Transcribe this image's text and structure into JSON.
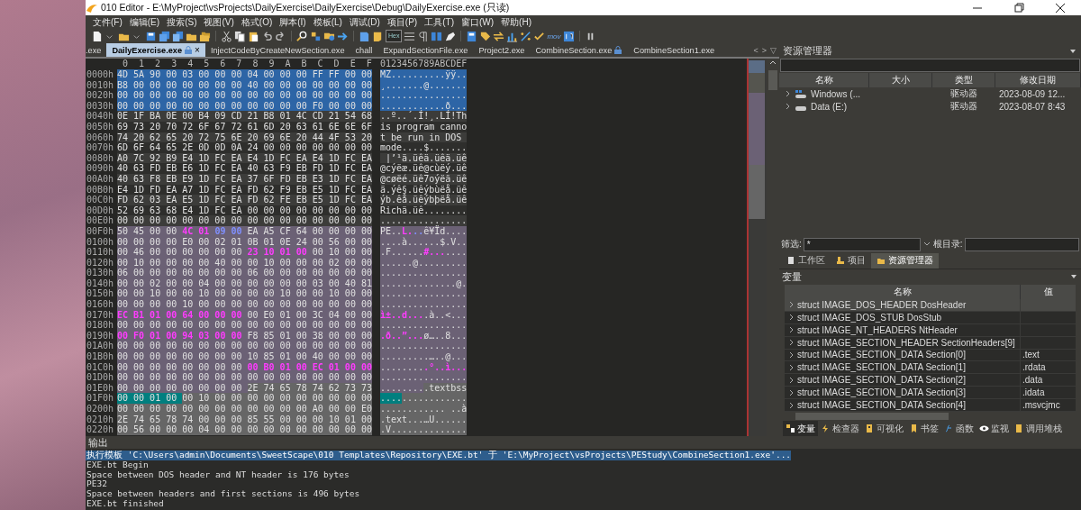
{
  "window": {
    "title": "010 Editor - E:\\MyProject\\vsProjects\\DailyExercise\\DailyExercise\\Debug\\DailyExercise.exe (只读)"
  },
  "menu": [
    "文件(F)",
    "编辑(E)",
    "搜索(S)",
    "视图(V)",
    "格式(O)",
    "脚本(I)",
    "模板(L)",
    "调试(D)",
    "项目(P)",
    "工具(T)",
    "窗口(W)",
    "帮助(H)"
  ],
  "toolbar": {
    "hex_label": "Hex",
    "hex_mode_on": true,
    "mov_label": "mov"
  },
  "tabs": [
    {
      "label": ".exe",
      "selected": false,
      "locked": false
    },
    {
      "label": "DailyExercise.exe",
      "selected": true,
      "locked": true,
      "close": "×"
    },
    {
      "label": "InjectCodeByCreateNewSection.exe",
      "selected": false,
      "locked": false
    },
    {
      "label": "chall",
      "selected": false,
      "locked": false
    },
    {
      "label": "ExpandSectionFile.exe",
      "selected": false,
      "locked": false
    },
    {
      "label": "Project2.exe",
      "selected": false,
      "locked": false
    },
    {
      "label": "CombineSection.exe",
      "selected": false,
      "locked": true
    },
    {
      "label": "CombineSection1.exe",
      "selected": false,
      "locked": false
    }
  ],
  "tab_nav": [
    "<",
    ">",
    "▽"
  ],
  "hex": {
    "columns": [
      "0",
      "1",
      "2",
      "3",
      "4",
      "5",
      "6",
      "7",
      "8",
      "9",
      "A",
      "B",
      "C",
      "D",
      "E",
      "F"
    ],
    "ascii_header": "0123456789ABCDEF",
    "rows": [
      {
        "offset": "0000h",
        "segments": [
          {
            "kind": "dos_header",
            "hex": "4D 5A 90 00 03 00 00 00 04 00 00 00 FF FF 00 00",
            "ascii": "MZ..........ÿÿ.."
          }
        ]
      },
      {
        "offset": "0010h",
        "segments": [
          {
            "kind": "dos_header",
            "hex": "B8 00 00 00 00 00 00 00 40 00 00 00 00 00 00 00",
            "ascii": "¸.......@......."
          }
        ]
      },
      {
        "offset": "0020h",
        "segments": [
          {
            "kind": "dos_header",
            "hex": "00 00 00 00 00 00 00 00 00 00 00 00 00 00 00 00",
            "ascii": "................"
          }
        ]
      },
      {
        "offset": "0030h",
        "segments": [
          {
            "kind": "dos_header",
            "hex": "00 00 00 00 00 00 00 00 00 00 00 00 F0 00 00 00",
            "ascii": "............ð..."
          }
        ]
      },
      {
        "offset": "0040h",
        "segments": [
          {
            "kind": "dos_stub",
            "hex": "0E 1F BA 0E 00 B4 09 CD 21 B8 01 4C CD 21 54 68",
            "ascii": "..º..´.Í!¸.LÍ!Th"
          }
        ]
      },
      {
        "offset": "0050h",
        "segments": [
          {
            "kind": "dos_stub",
            "hex": "69 73 20 70 72 6F 67 72 61 6D 20 63 61 6E 6E 6F",
            "ascii": "is program canno"
          }
        ]
      },
      {
        "offset": "0060h",
        "segments": [
          {
            "kind": "dos_stub",
            "hex": "74 20 62 65 20 72 75 6E 20 69 6E 20 44 4F 53 20",
            "ascii": "t be run in DOS "
          }
        ]
      },
      {
        "offset": "0070h",
        "segments": [
          {
            "kind": "dos_stub",
            "hex": "6D 6F 64 65 2E 0D 0D 0A 24 00 00 00 00 00 00 00",
            "ascii": "mode....$......."
          }
        ]
      },
      {
        "offset": "0080h",
        "segments": [
          {
            "kind": "dos_stub",
            "hex": "A0 7C 92 B9 E4 1D FC EA E4 1D FC EA E4 1D FC EA",
            "ascii": " |’¹ä.üêä.üêä.üê"
          }
        ]
      },
      {
        "offset": "0090h",
        "segments": [
          {
            "kind": "dos_stub",
            "hex": "40 63 FD EB E6 1D FC EA 40 63 F9 EB FD 1D FC EA",
            "ascii": "@cýëæ.üê@cùëý.üê"
          }
        ]
      },
      {
        "offset": "00A0h",
        "segments": [
          {
            "kind": "dos_stub",
            "hex": "40 63 F8 EB E9 1D FC EA 37 6F FD EB E3 1D FC EA",
            "ascii": "@cøëé.üê7oýëã.üê"
          }
        ]
      },
      {
        "offset": "00B0h",
        "segments": [
          {
            "kind": "dos_stub",
            "hex": "E4 1D FD EA A7 1D FC EA FD 62 F9 EB E5 1D FC EA",
            "ascii": "ä.ýê§.üêýbùëå.üê"
          }
        ]
      },
      {
        "offset": "00C0h",
        "segments": [
          {
            "kind": "dos_stub",
            "hex": "FD 62 03 EA E5 1D FC EA FD 62 FE EB E5 1D FC EA",
            "ascii": "ýb.êå.üêýbþëå.üê"
          }
        ]
      },
      {
        "offset": "00D0h",
        "segments": [
          {
            "kind": "dos_stub",
            "hex": "52 69 63 68 E4 1D FC EA 00 00 00 00 00 00 00 00",
            "ascii": "Richä.üê........"
          }
        ]
      },
      {
        "offset": "00E0h",
        "segments": [
          {
            "kind": "dos_stub",
            "hex": "00 00 00 00 00 00 00 00 00 00 00 00 00 00 00 00",
            "ascii": "................"
          }
        ]
      },
      {
        "offset": "00F0h",
        "segments": [
          {
            "kind": "nt_headers",
            "hex": "50 45 00 00",
            "ascii": "PE.."
          },
          {
            "kind": "nt_headers",
            "hex": "4C 01",
            "ascii": "L.",
            "color": "#ff3cff"
          },
          {
            "kind": "nt_headers",
            "hex": "09 00",
            "ascii": "..",
            "color": "#8090ff"
          },
          {
            "kind": "nt_headers",
            "hex": "EA A5 CF 64 00 00 00 00",
            "ascii": "ê¥Ïd...."
          }
        ]
      },
      {
        "offset": "0100h",
        "segments": [
          {
            "kind": "nt_headers",
            "hex": "00 00 00 00 E0 00 02 01 0B 01 0E 24 00 56 00 00",
            "ascii": "....à......$.V.."
          }
        ]
      },
      {
        "offset": "0110h",
        "segments": [
          {
            "kind": "nt_headers",
            "hex": "00 46 00 00 00 00 00 00",
            "ascii": ".F......"
          },
          {
            "kind": "nt_headers",
            "hex": "23 10 01 00",
            "ascii": "#...",
            "color": "#ff3cff"
          },
          {
            "kind": "nt_headers",
            "hex": "00 10 00 00",
            "ascii": "...."
          }
        ]
      },
      {
        "offset": "0120h",
        "segments": [
          {
            "kind": "nt_headers",
            "hex": "00 10 00 00 00 00 40 00 00 10 00 00 00 02 00 00",
            "ascii": "......@........."
          }
        ]
      },
      {
        "offset": "0130h",
        "segments": [
          {
            "kind": "nt_headers",
            "hex": "06 00 00 00 00 00 00 00 06 00 00 00 00 00 00 00",
            "ascii": "................"
          }
        ]
      },
      {
        "offset": "0140h",
        "segments": [
          {
            "kind": "nt_headers",
            "hex": "00 00 02 00 00 04 00 00 00 00 00 00 03 00 40 81",
            "ascii": "..............@."
          }
        ]
      },
      {
        "offset": "0150h",
        "segments": [
          {
            "kind": "nt_headers",
            "hex": "00 00 10 00 00 10 00 00 00 00 10 00 00 10 00 00",
            "ascii": "................"
          }
        ]
      },
      {
        "offset": "0160h",
        "segments": [
          {
            "kind": "nt_headers",
            "hex": "00 00 00 00 10 00 00 00 00 00 00 00 00 00 00 00",
            "ascii": "................"
          }
        ]
      },
      {
        "offset": "0170h",
        "segments": [
          {
            "kind": "nt_headers",
            "hex": "EC B1 01 00 64 00 00 00",
            "ascii": "ì±..d...",
            "color": "#ff3cff"
          },
          {
            "kind": "nt_headers",
            "hex": "00 E0 01 00 3C 04 00 00",
            "ascii": ".à..<..."
          }
        ]
      },
      {
        "offset": "0180h",
        "segments": [
          {
            "kind": "nt_headers",
            "hex": "00 00 00 00 00 00 00 00 00 00 00 00 00 00 00 00",
            "ascii": "................"
          }
        ]
      },
      {
        "offset": "0190h",
        "segments": [
          {
            "kind": "nt_headers",
            "hex": "00 F0 01 00 94 03 00 00",
            "ascii": ".ð..”...",
            "color": "#ff3cff"
          },
          {
            "kind": "nt_headers",
            "hex": "F8 85 01 00 38 00 00 00",
            "ascii": "ø…..8..."
          }
        ]
      },
      {
        "offset": "01A0h",
        "segments": [
          {
            "kind": "nt_headers",
            "hex": "00 00 00 00 00 00 00 00 00 00 00 00 00 00 00 00",
            "ascii": "................"
          }
        ]
      },
      {
        "offset": "01B0h",
        "segments": [
          {
            "kind": "nt_headers",
            "hex": "00 00 00 00 00 00 00 00 10 85 01 00 40 00 00 00",
            "ascii": ".........…..@..."
          }
        ]
      },
      {
        "offset": "01C0h",
        "segments": [
          {
            "kind": "nt_headers",
            "hex": "00 00 00 00 00 00 00 00",
            "ascii": "........"
          },
          {
            "kind": "nt_headers",
            "hex": "00 B0 01 00 EC 01 00 00",
            "ascii": ".°..ì...",
            "color": "#ff3cff"
          }
        ]
      },
      {
        "offset": "01D0h",
        "segments": [
          {
            "kind": "nt_headers",
            "hex": "00 00 00 00 00 00 00 00 00 00 00 00 00 00 00 00",
            "ascii": "................"
          }
        ]
      },
      {
        "offset": "01E0h",
        "segments": [
          {
            "kind": "nt_headers",
            "hex": "00 00 00 00 00 00 00 00",
            "ascii": "........"
          },
          {
            "kind": "section_headers",
            "hex": "2E 74 65 78 74 62 73 73",
            "ascii": ".textbss"
          }
        ]
      },
      {
        "offset": "01F0h",
        "segments": [
          {
            "kind": "selected",
            "hex": "00 00 01 00",
            "ascii": "...."
          },
          {
            "kind": "section_headers",
            "hex": "00 10 00 00 00 00 00 00 00 00 00 00",
            "ascii": "............"
          }
        ]
      },
      {
        "offset": "0200h",
        "segments": [
          {
            "kind": "section_headers",
            "hex": "00 00 00 00 00 00 00 00 00 00 00 00 A0 00 00 E0",
            "ascii": "............ ..à"
          }
        ]
      },
      {
        "offset": "0210h",
        "segments": [
          {
            "kind": "section_headers",
            "hex": "2E 74 65 78 74 00 00 00 85 55 00 00 00 10 01 00",
            "ascii": ".text...…U......"
          }
        ]
      },
      {
        "offset": "0220h",
        "segments": [
          {
            "kind": "section_headers",
            "hex": "00 56 00 00 00 04 00 00 00 00 00 00 00 00 00 00",
            "ascii": ".V.............."
          }
        ]
      }
    ]
  },
  "explorer": {
    "title": "资源管理器",
    "columns": [
      "名称",
      "大小",
      "类型",
      "修改日期"
    ],
    "rows": [
      {
        "kind": "system_drive",
        "name": "Windows (...",
        "type": "驱动器",
        "modified": "2023-08-09 12..."
      },
      {
        "kind": "drive",
        "name": "Data (E:)",
        "type": "驱动器",
        "modified": "2023-08-07 8:43"
      }
    ],
    "filter_label": "筛选:",
    "filter_value": "*",
    "root_label": "根目录:"
  },
  "side_tabs": [
    {
      "label": "工作区",
      "selected": false
    },
    {
      "label": "项目",
      "selected": false
    },
    {
      "label": "资源管理器",
      "selected": true
    }
  ],
  "variables": {
    "title": "变量",
    "columns": [
      "名称",
      "值"
    ],
    "rows": [
      {
        "name": "struct IMAGE_DOS_HEADER DosHeader",
        "selected": true
      },
      {
        "name": "struct IMAGE_DOS_STUB DosStub",
        "selected": false
      },
      {
        "name": "struct IMAGE_NT_HEADERS NtHeader",
        "selected": false
      },
      {
        "name": "struct IMAGE_SECTION_HEADER SectionHeaders[9]",
        "selected": false
      },
      {
        "name": "struct IMAGE_SECTION_DATA Section[0]",
        "value": ".text",
        "selected": false
      },
      {
        "name": "struct IMAGE_SECTION_DATA Section[1]",
        "value": ".rdata",
        "selected": false
      },
      {
        "name": "struct IMAGE_SECTION_DATA Section[2]",
        "value": ".data",
        "selected": false
      },
      {
        "name": "struct IMAGE_SECTION_DATA Section[3]",
        "value": ".idata",
        "selected": false
      },
      {
        "name": "struct IMAGE_SECTION_DATA Section[4]",
        "value": ".msvcjmc",
        "selected": false
      }
    ]
  },
  "bottom_tabs": [
    {
      "label": "变量",
      "selected": true
    },
    {
      "label": "检查器",
      "selected": false
    },
    {
      "label": "可视化",
      "selected": false
    },
    {
      "label": "书签",
      "selected": false
    },
    {
      "label": "函数",
      "selected": false
    },
    {
      "label": "监视",
      "selected": false
    },
    {
      "label": "调用堆栈",
      "selected": false
    }
  ],
  "output": {
    "title": "输出",
    "lines": [
      {
        "text": "执行模板 'C:\\Users\\admin\\Documents\\SweetScape\\010 Templates\\Repository\\EXE.bt' 于 'E:\\MyProject\\vsProjects\\PEStudy\\CombineSection1.exe'...",
        "selected": true
      },
      {
        "text": "EXE.bt Begin",
        "selected": false
      },
      {
        "text": "Space between DOS header and NT header is 176 bytes",
        "selected": false
      },
      {
        "text": "PE32",
        "selected": false
      },
      {
        "text": "Space between headers and first sections is 496 bytes",
        "selected": false
      },
      {
        "text": "EXE.bt finished",
        "selected": false
      }
    ]
  }
}
